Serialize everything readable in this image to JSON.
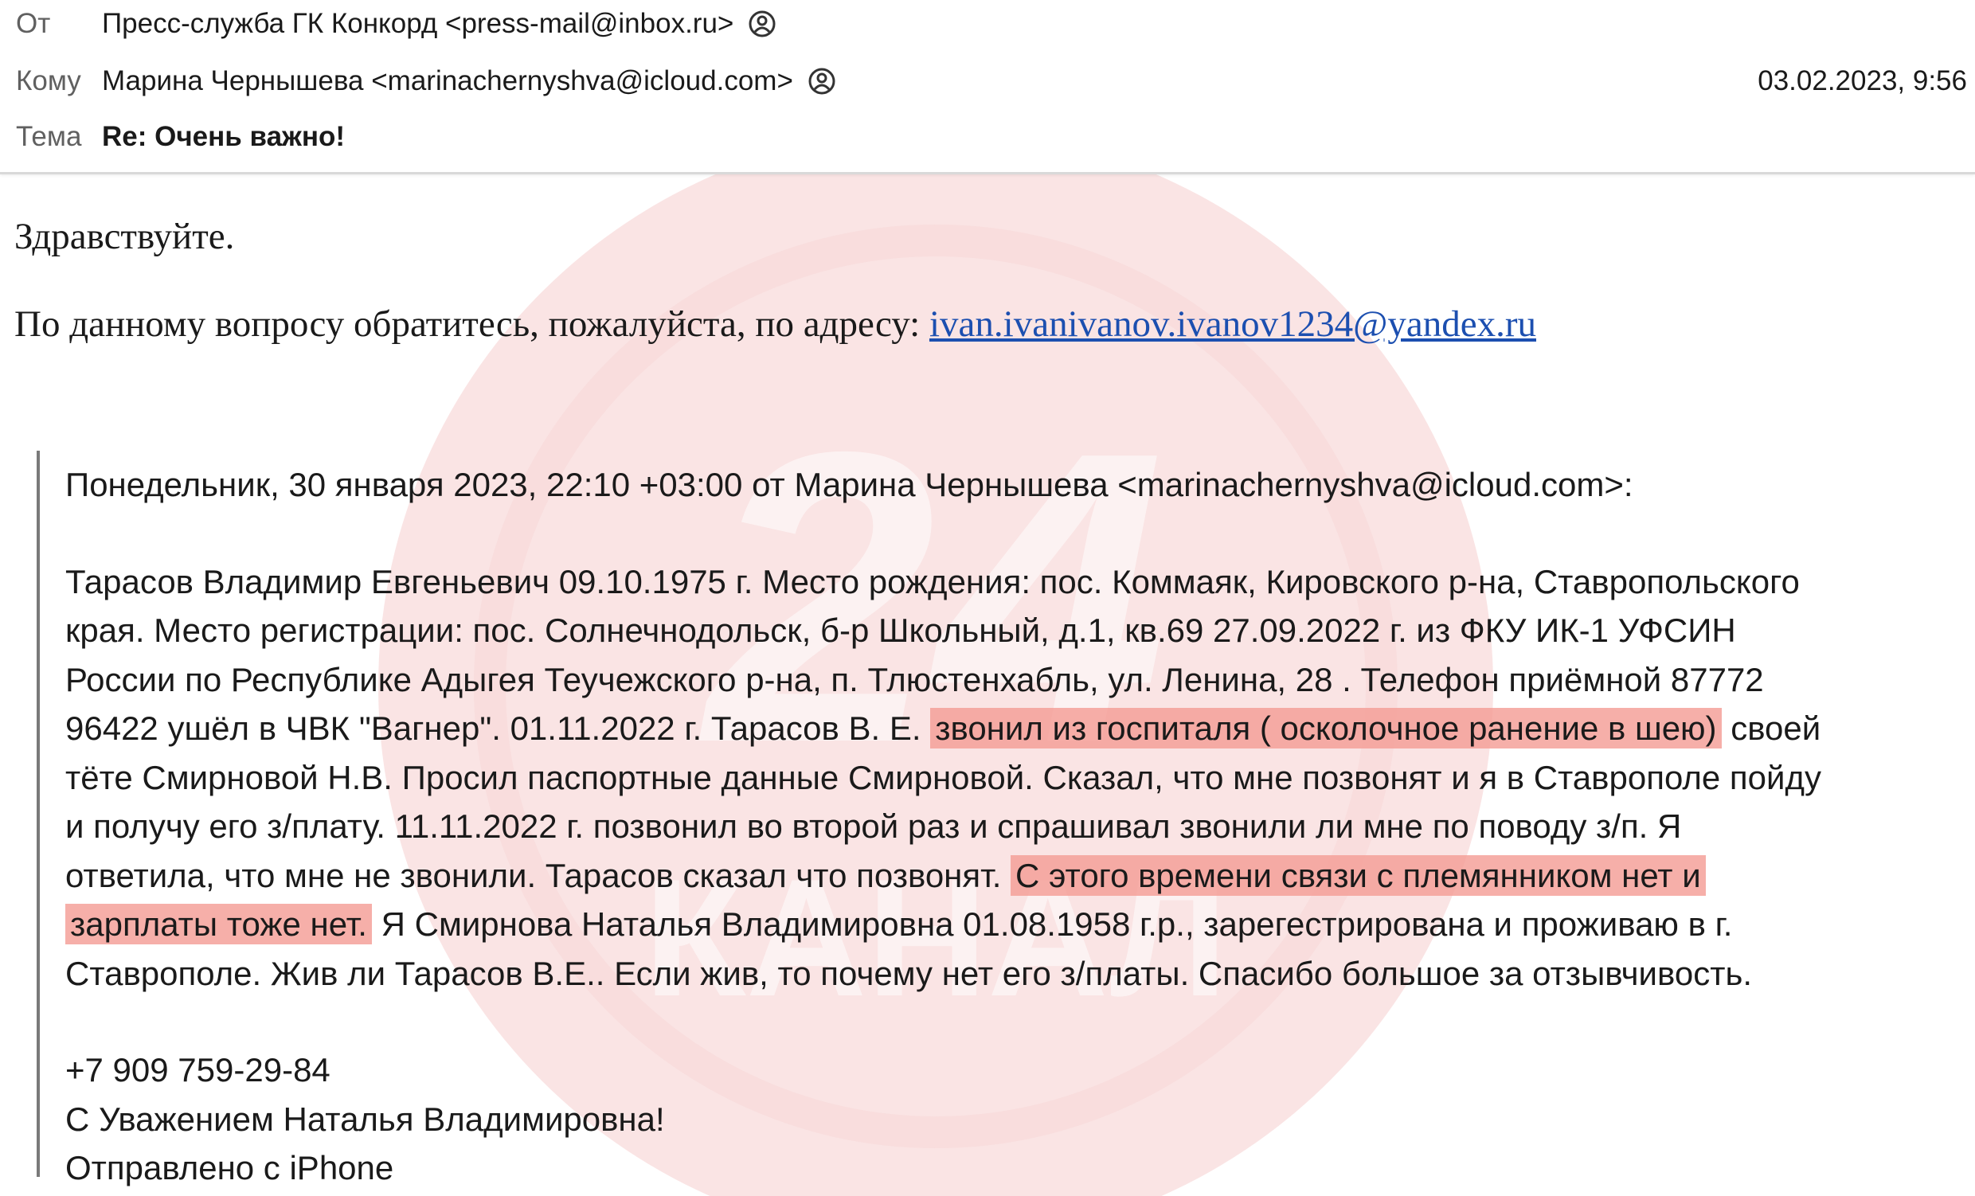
{
  "header": {
    "from_label": "От",
    "from_value": "Пресс-служба ГК Конкорд <press-mail@inbox.ru>",
    "to_label": "Кому",
    "to_value": "Марина Чернышева <marinachernyshva@icloud.com>",
    "date": "03.02.2023, 9:56",
    "subject_label": "Тема",
    "subject_value": "Re: Очень важно!"
  },
  "reply": {
    "greeting": "Здравствуйте.",
    "message": "По данному вопросу обратитесь, пожалуйста, по адресу: ",
    "link": "ivan.ivanivanov.ivanov1234@yandex.ru"
  },
  "quote": {
    "header_line": "Понедельник, 30 января 2023, 22:10 +03:00 от Марина Чернышева <marinachernyshva@icloud.com>:",
    "lines": [
      [
        {
          "text": "Тарасов Владимир Евгеньевич 09.10.1975 г. Место рождения: пос. Коммаяк, Кировского р-на, Ставропольского",
          "highlight": false
        }
      ],
      [
        {
          "text": "края. Место регистрации: пос. Солнечнодольск, б-р Школьный, д.1, кв.69 27.09.2022 г. из ФКУ ИК-1 УФСИН",
          "highlight": false
        }
      ],
      [
        {
          "text": "России по Республике Адыгея Теучежского р-на, п. Тлюстенхабль, ул. Ленина, 28 . Телефон приёмной 87772",
          "highlight": false
        }
      ],
      [
        {
          "text": "96422 ушёл в ЧВК \"Вагнер\". 01.11.2022 г. Тарасов В. Е. ",
          "highlight": false
        },
        {
          "text": "звонил из госпиталя ( осколочное ранение в шею)",
          "highlight": true
        },
        {
          "text": " своей",
          "highlight": false
        }
      ],
      [
        {
          "text": "тёте Смирновой Н.В. Просил паспортные данные Смирновой. Сказал, что мне позвонят и я в Ставрополе пойду",
          "highlight": false
        }
      ],
      [
        {
          "text": "и получу его з/плату. 11.11.2022 г. позвонил во второй раз и спрашивал звонили ли мне по поводу з/п. Я",
          "highlight": false
        }
      ],
      [
        {
          "text": "ответила, что мне не звонили. Тарасов сказал что позвонят. ",
          "highlight": false
        },
        {
          "text": "С этого времени связи с племянником нет и",
          "highlight": true
        }
      ],
      [
        {
          "text": "зарплаты тоже нет.",
          "highlight": true
        },
        {
          "text": " Я Смирнова Наталья Владимировна 01.08.1958 г.р., зарегестрирована и проживаю в г.",
          "highlight": false
        }
      ],
      [
        {
          "text": "Ставрополе. Жив ли Тарасов В.Е.. Если жив, то почему нет его з/платы. Спасибо большое за отзывчивость.",
          "highlight": false
        }
      ]
    ],
    "phone": "+7 909 759-29-84",
    "signoff": "С Уважением Наталья Владимировна!",
    "sent_from": "Отправлено с iPhone"
  },
  "watermark": {
    "number": "24",
    "word": "КАНАЛ",
    "color": "#e8a6a6"
  }
}
